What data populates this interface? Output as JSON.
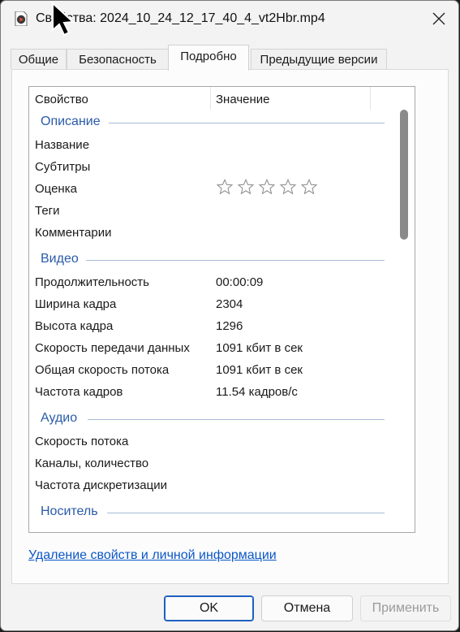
{
  "window": {
    "title": "Свойства: 2024_10_24_12_17_40_4_vt2Hbr.mp4"
  },
  "tabs": [
    {
      "label": "Общие"
    },
    {
      "label": "Безопасность"
    },
    {
      "label": "Подробно"
    },
    {
      "label": "Предыдущие версии"
    }
  ],
  "columns": {
    "property": "Свойство",
    "value": "Значение"
  },
  "groups": {
    "description": {
      "label": "Описание",
      "rows": {
        "title": {
          "name": "Название",
          "value": ""
        },
        "subtitles": {
          "name": "Субтитры",
          "value": ""
        },
        "rating": {
          "name": "Оценка",
          "stars": 0,
          "max_stars": 5
        },
        "tags": {
          "name": "Теги",
          "value": ""
        },
        "comments": {
          "name": "Комментарии",
          "value": ""
        }
      }
    },
    "video": {
      "label": "Видео",
      "rows": {
        "duration": {
          "name": "Продолжительность",
          "value": "00:00:09"
        },
        "width": {
          "name": "Ширина кадра",
          "value": "2304"
        },
        "height": {
          "name": "Высота кадра",
          "value": "1296"
        },
        "data_rate": {
          "name": "Скорость передачи данных",
          "value": "1091 кбит в сек"
        },
        "total_bitrate": {
          "name": "Общая скорость потока",
          "value": "1091 кбит в сек"
        },
        "frame_rate": {
          "name": "Частота кадров",
          "value": "11.54 кадров/с"
        }
      }
    },
    "audio": {
      "label": "Аудио",
      "rows": {
        "bitrate": {
          "name": "Скорость потока",
          "value": ""
        },
        "channels": {
          "name": "Каналы, количество",
          "value": ""
        },
        "sample_rate": {
          "name": "Частота дискретизации",
          "value": ""
        }
      }
    },
    "media": {
      "label": "Носитель"
    }
  },
  "links": {
    "remove_properties": "Удаление свойств и личной информации"
  },
  "buttons": {
    "ok": "OK",
    "cancel": "Отмена",
    "apply": "Применить"
  },
  "colors": {
    "group_text": "#2a5ba8",
    "link": "#0b57c7",
    "accent": "#1f5fbf"
  }
}
